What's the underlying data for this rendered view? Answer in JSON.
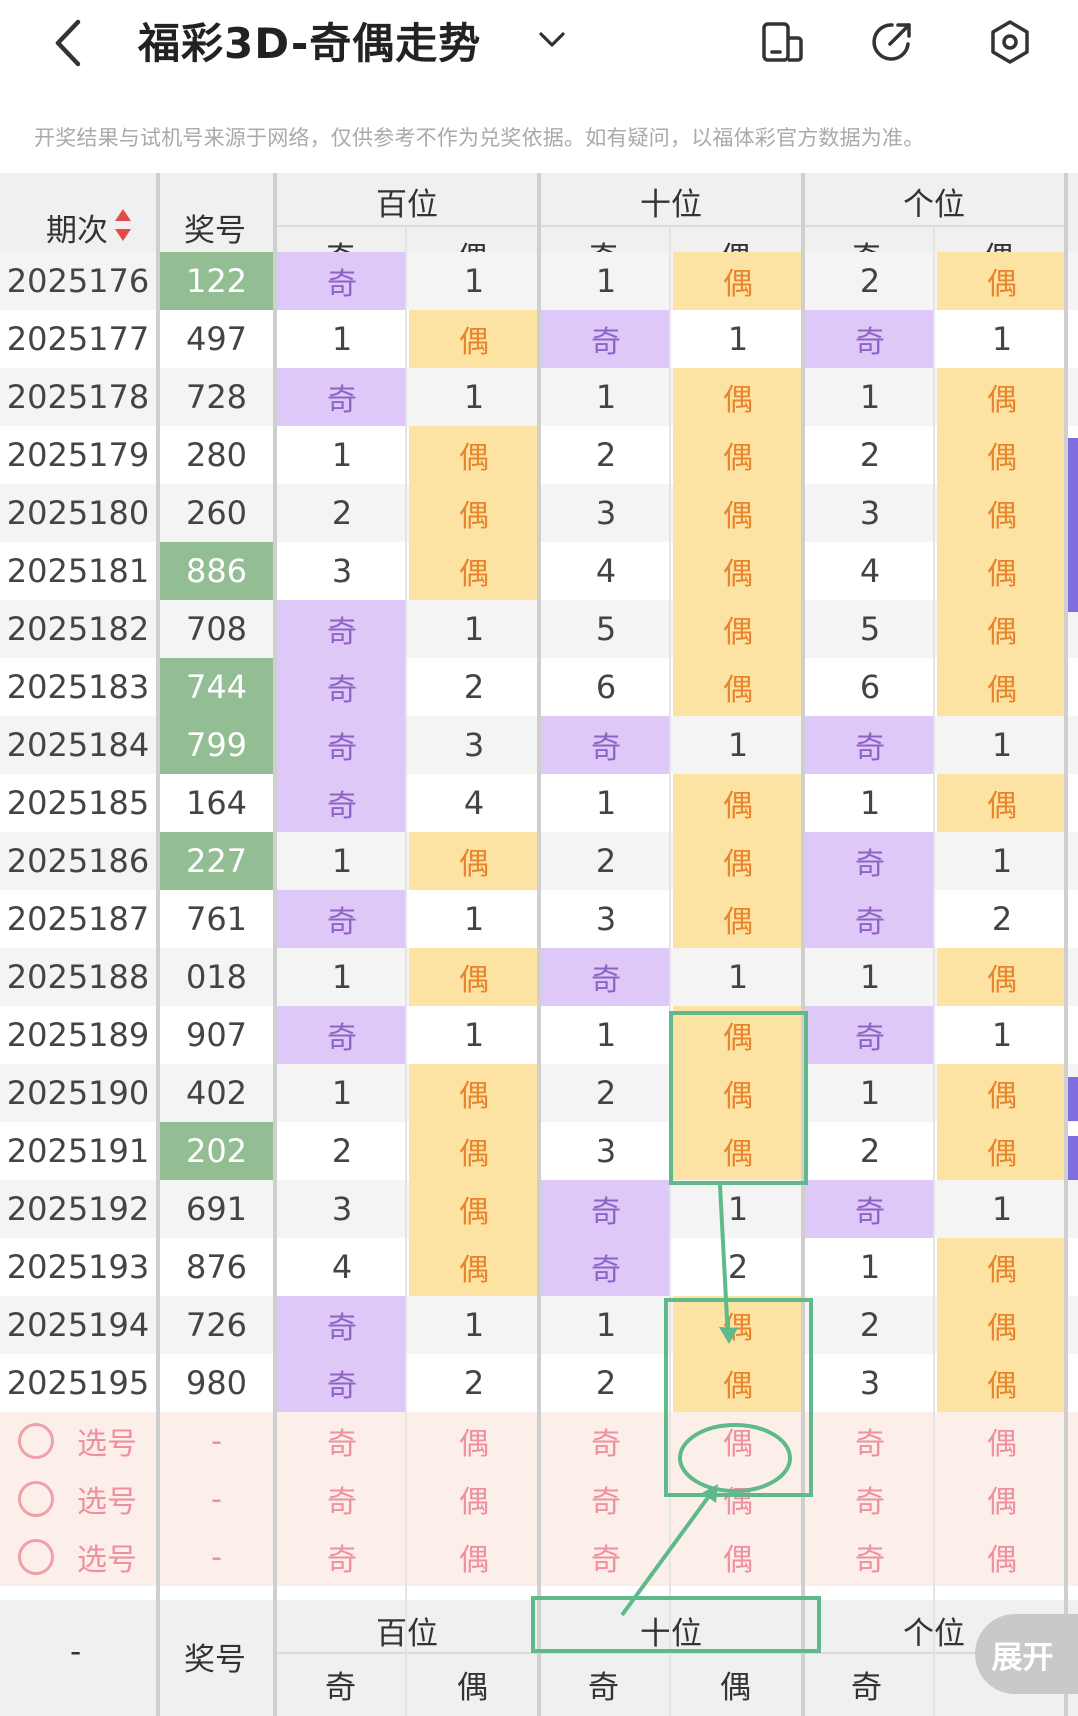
{
  "header": {
    "title": "福彩3D-奇偶走势",
    "notice": "开奖结果与试机号来源于网络，仅供参考不作为兑奖依据。如有疑问，以福体彩官方数据为准。"
  },
  "table": {
    "col_period": "期次",
    "col_number": "奖号",
    "groups": [
      "百位",
      "十位",
      "个位"
    ],
    "sub_odd": "奇",
    "sub_even": "偶",
    "rows": [
      {
        "period": "2025176",
        "number": "122",
        "hl": true,
        "cells": [
          [
            "奇",
            "o"
          ],
          [
            "1",
            "p"
          ],
          [
            "1",
            "p"
          ],
          [
            "偶",
            "e"
          ],
          [
            "2",
            "p"
          ],
          [
            "偶",
            "e"
          ]
        ]
      },
      {
        "period": "2025177",
        "number": "497",
        "hl": false,
        "cells": [
          [
            "1",
            "p"
          ],
          [
            "偶",
            "e"
          ],
          [
            "奇",
            "o"
          ],
          [
            "1",
            "p"
          ],
          [
            "奇",
            "o"
          ],
          [
            "1",
            "p"
          ]
        ]
      },
      {
        "period": "2025178",
        "number": "728",
        "hl": false,
        "cells": [
          [
            "奇",
            "o"
          ],
          [
            "1",
            "p"
          ],
          [
            "1",
            "p"
          ],
          [
            "偶",
            "e"
          ],
          [
            "1",
            "p"
          ],
          [
            "偶",
            "e"
          ]
        ]
      },
      {
        "period": "2025179",
        "number": "280",
        "hl": false,
        "cells": [
          [
            "1",
            "p"
          ],
          [
            "偶",
            "e"
          ],
          [
            "2",
            "p"
          ],
          [
            "偶",
            "e"
          ],
          [
            "2",
            "p"
          ],
          [
            "偶",
            "e"
          ]
        ]
      },
      {
        "period": "2025180",
        "number": "260",
        "hl": false,
        "cells": [
          [
            "2",
            "p"
          ],
          [
            "偶",
            "e"
          ],
          [
            "3",
            "p"
          ],
          [
            "偶",
            "e"
          ],
          [
            "3",
            "p"
          ],
          [
            "偶",
            "e"
          ]
        ]
      },
      {
        "period": "2025181",
        "number": "886",
        "hl": true,
        "cells": [
          [
            "3",
            "p"
          ],
          [
            "偶",
            "e"
          ],
          [
            "4",
            "p"
          ],
          [
            "偶",
            "e"
          ],
          [
            "4",
            "p"
          ],
          [
            "偶",
            "e"
          ]
        ]
      },
      {
        "period": "2025182",
        "number": "708",
        "hl": false,
        "cells": [
          [
            "奇",
            "o"
          ],
          [
            "1",
            "p"
          ],
          [
            "5",
            "p"
          ],
          [
            "偶",
            "e"
          ],
          [
            "5",
            "p"
          ],
          [
            "偶",
            "e"
          ]
        ]
      },
      {
        "period": "2025183",
        "number": "744",
        "hl": true,
        "cells": [
          [
            "奇",
            "o"
          ],
          [
            "2",
            "p"
          ],
          [
            "6",
            "p"
          ],
          [
            "偶",
            "e"
          ],
          [
            "6",
            "p"
          ],
          [
            "偶",
            "e"
          ]
        ]
      },
      {
        "period": "2025184",
        "number": "799",
        "hl": true,
        "cells": [
          [
            "奇",
            "o"
          ],
          [
            "3",
            "p"
          ],
          [
            "奇",
            "o"
          ],
          [
            "1",
            "p"
          ],
          [
            "奇",
            "o"
          ],
          [
            "1",
            "p"
          ]
        ]
      },
      {
        "period": "2025185",
        "number": "164",
        "hl": false,
        "cells": [
          [
            "奇",
            "o"
          ],
          [
            "4",
            "p"
          ],
          [
            "1",
            "p"
          ],
          [
            "偶",
            "e"
          ],
          [
            "1",
            "p"
          ],
          [
            "偶",
            "e"
          ]
        ]
      },
      {
        "period": "2025186",
        "number": "227",
        "hl": true,
        "cells": [
          [
            "1",
            "p"
          ],
          [
            "偶",
            "e"
          ],
          [
            "2",
            "p"
          ],
          [
            "偶",
            "e"
          ],
          [
            "奇",
            "o"
          ],
          [
            "1",
            "p"
          ]
        ]
      },
      {
        "period": "2025187",
        "number": "761",
        "hl": false,
        "cells": [
          [
            "奇",
            "o"
          ],
          [
            "1",
            "p"
          ],
          [
            "3",
            "p"
          ],
          [
            "偶",
            "e"
          ],
          [
            "奇",
            "o"
          ],
          [
            "2",
            "p"
          ]
        ]
      },
      {
        "period": "2025188",
        "number": "018",
        "hl": false,
        "cells": [
          [
            "1",
            "p"
          ],
          [
            "偶",
            "e"
          ],
          [
            "奇",
            "o"
          ],
          [
            "1",
            "p"
          ],
          [
            "1",
            "p"
          ],
          [
            "偶",
            "e"
          ]
        ]
      },
      {
        "period": "2025189",
        "number": "907",
        "hl": false,
        "cells": [
          [
            "奇",
            "o"
          ],
          [
            "1",
            "p"
          ],
          [
            "1",
            "p"
          ],
          [
            "偶",
            "e"
          ],
          [
            "奇",
            "o"
          ],
          [
            "1",
            "p"
          ]
        ]
      },
      {
        "period": "2025190",
        "number": "402",
        "hl": false,
        "cells": [
          [
            "1",
            "p"
          ],
          [
            "偶",
            "e"
          ],
          [
            "2",
            "p"
          ],
          [
            "偶",
            "e"
          ],
          [
            "1",
            "p"
          ],
          [
            "偶",
            "e"
          ]
        ]
      },
      {
        "period": "2025191",
        "number": "202",
        "hl": true,
        "cells": [
          [
            "2",
            "p"
          ],
          [
            "偶",
            "e"
          ],
          [
            "3",
            "p"
          ],
          [
            "偶",
            "e"
          ],
          [
            "2",
            "p"
          ],
          [
            "偶",
            "e"
          ]
        ]
      },
      {
        "period": "2025192",
        "number": "691",
        "hl": false,
        "cells": [
          [
            "3",
            "p"
          ],
          [
            "偶",
            "e"
          ],
          [
            "奇",
            "o"
          ],
          [
            "1",
            "p"
          ],
          [
            "奇",
            "o"
          ],
          [
            "1",
            "p"
          ]
        ]
      },
      {
        "period": "2025193",
        "number": "876",
        "hl": false,
        "cells": [
          [
            "4",
            "p"
          ],
          [
            "偶",
            "e"
          ],
          [
            "奇",
            "o"
          ],
          [
            "2",
            "p"
          ],
          [
            "1",
            "p"
          ],
          [
            "偶",
            "e"
          ]
        ]
      },
      {
        "period": "2025194",
        "number": "726",
        "hl": false,
        "cells": [
          [
            "奇",
            "o"
          ],
          [
            "1",
            "p"
          ],
          [
            "1",
            "p"
          ],
          [
            "偶",
            "e"
          ],
          [
            "2",
            "p"
          ],
          [
            "偶",
            "e"
          ]
        ]
      },
      {
        "period": "2025195",
        "number": "980",
        "hl": false,
        "cells": [
          [
            "奇",
            "o"
          ],
          [
            "2",
            "p"
          ],
          [
            "2",
            "p"
          ],
          [
            "偶",
            "e"
          ],
          [
            "3",
            "p"
          ],
          [
            "偶",
            "e"
          ]
        ]
      }
    ],
    "pick_rows": [
      {
        "label": "选号",
        "dash": "-",
        "cells": [
          "奇",
          "偶",
          "奇",
          "偶",
          "奇",
          "偶"
        ]
      },
      {
        "label": "选号",
        "dash": "-",
        "cells": [
          "奇",
          "偶",
          "奇",
          "偶",
          "奇",
          "偶"
        ]
      },
      {
        "label": "选号",
        "dash": "-",
        "cells": [
          "奇",
          "偶",
          "奇",
          "偶",
          "奇",
          "偶"
        ]
      }
    ],
    "footer": {
      "period_dash": "-",
      "number": "奖号",
      "groups": [
        "百位",
        "十位",
        "个位"
      ],
      "subs": [
        "奇",
        "偶",
        "奇",
        "偶",
        "奇"
      ]
    }
  },
  "expand_label": "展开",
  "colors": {
    "odd_bg": "#ddc8f8",
    "odd_fg": "#8f63c6",
    "even_bg": "#fde3a3",
    "even_fg": "#e8842c",
    "hl_bg": "#93bd93",
    "annotation": "#5fb98a"
  }
}
